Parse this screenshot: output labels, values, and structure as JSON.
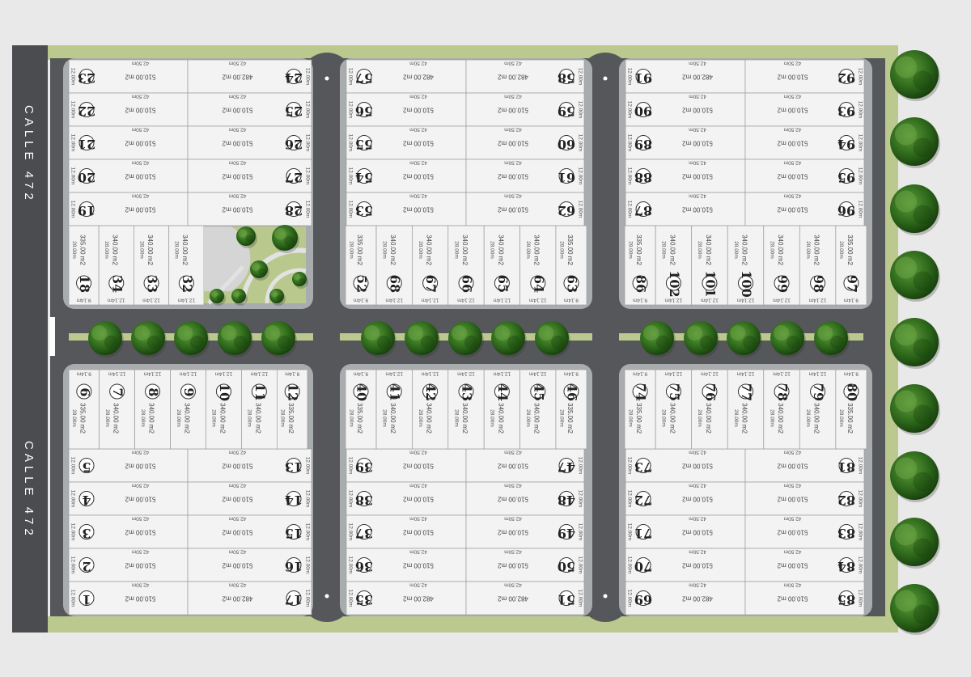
{
  "colors": {
    "background": "#e9e9e9",
    "green_strip": "#bcc98e",
    "road": "#55575a",
    "block_border": "#a9acaf",
    "lot_fill": "#f3f3f3",
    "lot_line": "#9a9a9a",
    "street": "#4a4c4f",
    "tree_dark": "#1f4d12",
    "tree_light": "#4c8a2e",
    "plaza": "#b9c98e"
  },
  "icons": {
    "tree": "tree-icon",
    "roundabout": "cul-de-sac-icon"
  },
  "street": {
    "name_top": "CALLE 472",
    "name_bottom": "CALLE 472"
  },
  "blocks": [
    {
      "id": "nw",
      "wide_rows": [
        {
          "left": {
            "num": "23",
            "area": "510.00 m2"
          },
          "right": {
            "num": "24",
            "area": "482.00 m2"
          }
        },
        {
          "left": {
            "num": "22",
            "area": "510.00 m2"
          },
          "right": {
            "num": "25",
            "area": "510.00 m2"
          }
        },
        {
          "left": {
            "num": "21",
            "area": "510.00 m2"
          },
          "right": {
            "num": "26",
            "area": "510.00 m2"
          }
        },
        {
          "left": {
            "num": "20",
            "area": "510.00 m2"
          },
          "right": {
            "num": "27",
            "area": "510.00 m2"
          }
        },
        {
          "left": {
            "num": "19",
            "area": "510.00 m2"
          },
          "right": {
            "num": "28",
            "area": "510.00 m2"
          }
        }
      ],
      "narrow": [
        {
          "num": "18",
          "area": "335.00 m2",
          "width": "9.14m"
        },
        {
          "num": "34",
          "area": "340.00 m2",
          "width": "12.14m"
        },
        {
          "num": "33",
          "area": "340.00 m2",
          "width": "12.14m"
        },
        {
          "num": "32",
          "area": "340.00 m2",
          "width": "12.14m"
        }
      ]
    },
    {
      "id": "nc",
      "wide_rows": [
        {
          "left": {
            "num": "57",
            "area": "482.00 m2"
          },
          "right": {
            "num": "58",
            "area": "482.00 m2"
          }
        },
        {
          "left": {
            "num": "56",
            "area": "510.00 m2"
          },
          "right": {
            "num": "59",
            "area": "510.00 m2"
          }
        },
        {
          "left": {
            "num": "55",
            "area": "510.00 m2"
          },
          "right": {
            "num": "60",
            "area": "510.00 m2"
          }
        },
        {
          "left": {
            "num": "54",
            "area": "510.00 m2"
          },
          "right": {
            "num": "61",
            "area": "510.00 m2"
          }
        },
        {
          "left": {
            "num": "53",
            "area": "510.00 m2"
          },
          "right": {
            "num": "62",
            "area": "510.00 m2"
          }
        }
      ],
      "narrow": [
        {
          "num": "52",
          "area": "335.00 m2",
          "width": "9.14m"
        },
        {
          "num": "68",
          "area": "340.00 m2",
          "width": "12.14m"
        },
        {
          "num": "67",
          "area": "340.00 m2",
          "width": "12.14m"
        },
        {
          "num": "66",
          "area": "340.00 m2",
          "width": "12.14m"
        },
        {
          "num": "65",
          "area": "340.00 m2",
          "width": "12.14m"
        },
        {
          "num": "64",
          "area": "340.00 m2",
          "width": "12.14m"
        },
        {
          "num": "63",
          "area": "335.00 m2",
          "width": "9.14m"
        }
      ]
    },
    {
      "id": "ne",
      "wide_rows": [
        {
          "left": {
            "num": "91",
            "area": "482.00 m2"
          },
          "right": {
            "num": "92",
            "area": "510.00 m2"
          }
        },
        {
          "left": {
            "num": "90",
            "area": "510.00 m2"
          },
          "right": {
            "num": "93",
            "area": "510.00 m2"
          }
        },
        {
          "left": {
            "num": "89",
            "area": "510.00 m2"
          },
          "right": {
            "num": "94",
            "area": "510.00 m2"
          }
        },
        {
          "left": {
            "num": "88",
            "area": "510.00 m2"
          },
          "right": {
            "num": "95",
            "area": "510.00 m2"
          }
        },
        {
          "left": {
            "num": "87",
            "area": "510.00 m2"
          },
          "right": {
            "num": "96",
            "area": "510.00 m2"
          }
        }
      ],
      "narrow": [
        {
          "num": "86",
          "area": "335.00 m2",
          "width": "9.14m"
        },
        {
          "num": "102",
          "area": "340.00 m2",
          "width": "12.14m"
        },
        {
          "num": "101",
          "area": "340.00 m2",
          "width": "12.14m"
        },
        {
          "num": "100",
          "area": "340.00 m2",
          "width": "12.14m"
        },
        {
          "num": "99",
          "area": "340.00 m2",
          "width": "12.14m"
        },
        {
          "num": "98",
          "area": "340.00 m2",
          "width": "12.14m"
        },
        {
          "num": "97",
          "area": "335.00 m2",
          "width": "9.14m"
        }
      ]
    },
    {
      "id": "sw",
      "narrow": [
        {
          "num": "6",
          "area": "335.00 m2",
          "width": "9.14m"
        },
        {
          "num": "7",
          "area": "340.00 m2",
          "width": "12.14m"
        },
        {
          "num": "8",
          "area": "340.00 m2",
          "width": "12.14m"
        },
        {
          "num": "9",
          "area": "340.00 m2",
          "width": "12.14m"
        },
        {
          "num": "10",
          "area": "340.00 m2",
          "width": "12.14m"
        },
        {
          "num": "11",
          "area": "340.00 m2",
          "width": "12.14m"
        },
        {
          "num": "12",
          "area": "335.00 m2",
          "width": "9.14m"
        }
      ],
      "wide_rows": [
        {
          "left": {
            "num": "5",
            "area": "510.00 m2"
          },
          "right": {
            "num": "13",
            "area": "510.00 m2"
          }
        },
        {
          "left": {
            "num": "4",
            "area": "510.00 m2"
          },
          "right": {
            "num": "14",
            "area": "510.00 m2"
          }
        },
        {
          "left": {
            "num": "3",
            "area": "510.00 m2"
          },
          "right": {
            "num": "15",
            "area": "510.00 m2"
          }
        },
        {
          "left": {
            "num": "2",
            "area": "510.00 m2"
          },
          "right": {
            "num": "16",
            "area": "510.00 m2"
          }
        },
        {
          "left": {
            "num": "1",
            "area": "510.00 m2"
          },
          "right": {
            "num": "17",
            "area": "482.00 m2"
          }
        }
      ]
    },
    {
      "id": "sc",
      "narrow": [
        {
          "num": "40",
          "area": "335.00 m2",
          "width": "9.14m"
        },
        {
          "num": "41",
          "area": "340.00 m2",
          "width": "12.14m"
        },
        {
          "num": "42",
          "area": "340.00 m2",
          "width": "12.14m"
        },
        {
          "num": "43",
          "area": "340.00 m2",
          "width": "12.14m"
        },
        {
          "num": "44",
          "area": "340.00 m2",
          "width": "12.14m"
        },
        {
          "num": "45",
          "area": "340.00 m2",
          "width": "12.14m"
        },
        {
          "num": "46",
          "area": "335.00 m2",
          "width": "9.14m"
        }
      ],
      "wide_rows": [
        {
          "left": {
            "num": "39",
            "area": "510.00 m2"
          },
          "right": {
            "num": "47",
            "area": "510.00 m2"
          }
        },
        {
          "left": {
            "num": "38",
            "area": "510.00 m2"
          },
          "right": {
            "num": "48",
            "area": "510.00 m2"
          }
        },
        {
          "left": {
            "num": "37",
            "area": "510.00 m2"
          },
          "right": {
            "num": "49",
            "area": "510.00 m2"
          }
        },
        {
          "left": {
            "num": "36",
            "area": "510.00 m2"
          },
          "right": {
            "num": "50",
            "area": "510.00 m2"
          }
        },
        {
          "left": {
            "num": "35",
            "area": "482.00 m2"
          },
          "right": {
            "num": "51",
            "area": "482.00 m2"
          }
        }
      ]
    },
    {
      "id": "se",
      "narrow": [
        {
          "num": "74",
          "area": "335.00 m2",
          "width": "9.14m"
        },
        {
          "num": "75",
          "area": "340.00 m2",
          "width": "12.14m"
        },
        {
          "num": "76",
          "area": "340.00 m2",
          "width": "12.14m"
        },
        {
          "num": "77",
          "area": "340.00 m2",
          "width": "12.14m"
        },
        {
          "num": "78",
          "area": "340.00 m2",
          "width": "12.14m"
        },
        {
          "num": "79",
          "area": "340.00 m2",
          "width": "12.14m"
        },
        {
          "num": "80",
          "area": "335.00 m2",
          "width": "9.14m"
        }
      ],
      "wide_rows": [
        {
          "left": {
            "num": "73",
            "area": "510.00 m2"
          },
          "right": {
            "num": "81",
            "area": "510.00 m2"
          }
        },
        {
          "left": {
            "num": "72",
            "area": "510.00 m2"
          },
          "right": {
            "num": "82",
            "area": "510.00 m2"
          }
        },
        {
          "left": {
            "num": "71",
            "area": "510.00 m2"
          },
          "right": {
            "num": "83",
            "area": "510.00 m2"
          }
        },
        {
          "left": {
            "num": "70",
            "area": "510.00 m2"
          },
          "right": {
            "num": "84",
            "area": "510.00 m2"
          }
        },
        {
          "left": {
            "num": "69",
            "area": "482.00 m2"
          },
          "right": {
            "num": "85",
            "area": "510.00 m2"
          }
        }
      ]
    }
  ],
  "dims": {
    "wide_width": "12.00m",
    "wide_depth": "42.50m",
    "narrow_depth": "28.00m"
  }
}
